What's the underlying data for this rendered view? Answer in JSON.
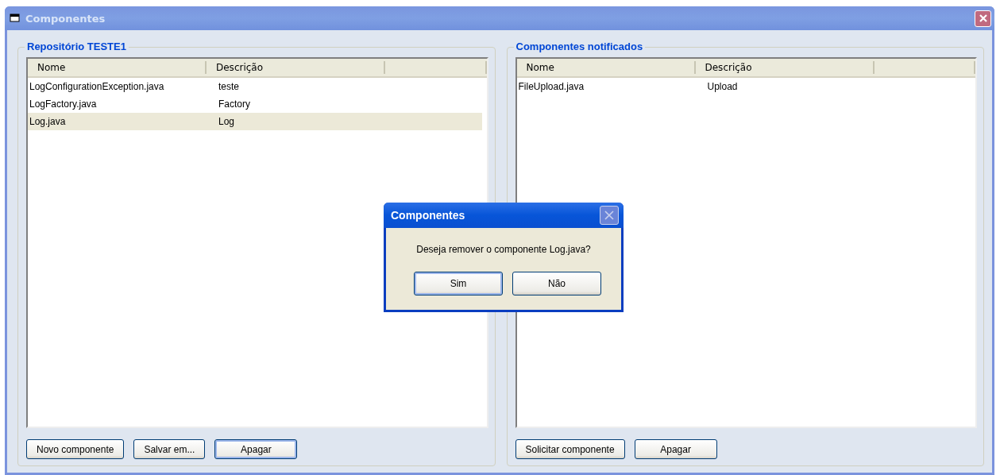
{
  "window": {
    "title": "Componentes"
  },
  "panels": [
    {
      "title": "Repositório TESTE1",
      "columns": [
        "Nome",
        "Descrição"
      ],
      "rows": [
        {
          "cells": [
            "LogConfigurationException.java",
            "teste"
          ],
          "selected": false
        },
        {
          "cells": [
            "LogFactory.java",
            "Factory"
          ],
          "selected": false
        },
        {
          "cells": [
            "Log.java",
            "Log"
          ],
          "selected": true
        }
      ],
      "buttons": [
        {
          "label": "Novo componente",
          "default": false
        },
        {
          "label": "Salvar em...",
          "default": false
        },
        {
          "label": "Apagar",
          "default": true
        }
      ]
    },
    {
      "title": "Componentes notificados",
      "columns": [
        "Nome",
        "Descrição"
      ],
      "rows": [
        {
          "cells": [
            "FileUpload.java",
            "Upload"
          ],
          "selected": false
        }
      ],
      "buttons": [
        {
          "label": "Solicitar componente",
          "default": false
        },
        {
          "label": "Apagar",
          "default": false
        }
      ]
    }
  ],
  "dialog": {
    "title": "Componentes",
    "message": "Deseja remover o componente Log.java?",
    "buttons": [
      {
        "label": "Sim",
        "default": true
      },
      {
        "label": "Não",
        "default": false
      }
    ]
  }
}
